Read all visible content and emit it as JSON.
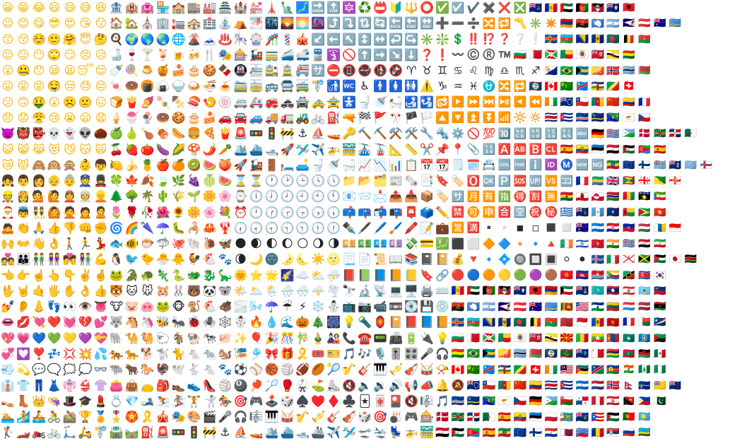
{
  "sheet": {
    "columns": 47,
    "rows": 28,
    "description_groups": [
      "faces",
      "buildings",
      "nature",
      "objects",
      "symbols",
      "flags"
    ]
  },
  "rows": [
    "😀😁😂😃😄😅😆🏦🏨🏩🏪🏫🏬🏭🏯🏰💒🗼🗽🗾🔜🔝🔯♻️📛🔰🔱⭕✅☑️✔️✖️❌❎🇦🇨🇦🇩🇦🇪🇦🇫🇦🇬🇦🇮🇦🇱",
    "😉😊😋😎😍😘😗🏠🏡⛪🏢🏣🏤🏥⛲⛺🌁🌃🌄🌅🌆⤴️⤵️🔃🔄🔙🔚🔛➕➖➗🔀🔁〽️✳️✴️🇦🇲🇦🇴🇦🇶🇦🇷🇦🇸🇦🇹🇦🇺🇦🇼",
    "😙😚☺️🙂🤗😇🤔🍳🌍🌎🌏🌐🌋🗻♨️🎠🎡🎢💈🎪↙️⬅️↖️↕️↔️↩️↪️✳️❇️💲‼️⁉️❓❔❕🇦🇽🇦🇿🇧🇦🇧🇧🇧🇩🇧🇪🇧🇫",
    "😐😑😶🙄😏😣😥🍶🍷🍸🍹🍺🍻🍴🎭🎰🚂🚃🚄🚅🚆🛐🚫⬆️➡️↘️⬇️❓❗〰️©️®️™️🇧🇬🇧🇭🇧🇮🇧🇯🇧🇱🇧🇲🇧🇳🇧🇴",
    "😮🤐😯😪😫😴😌🍼🍭🍮🍯🍰🎂🍪🍫🚇🚈🚉🚊🚝🈂️⛔📵🚭🚯🚱♈♉♊♋♌♍♎♏♐🇧🇶🇧🇷🇧🇸🇧🇹🇧🇻🇧🇼🇧🇾",
    "😛😜😝🤤😒😓😔🍬🍩🍘🍙🍚🍛🍜🍝🚞🚋🚌🚍🚎🚏🚮🚾♿🚹🚺🚻⚠️♑♒♓⛎🔀🔁🇧🇿🇨🇦🇨🇨🇨🇩🇨🇫🇨🇬🇨🇭",
    "😕🙃🤑😲☹️🙁😖🍞🍟🍠🍡🍢🍣🍤🍥🚐🚑🚒🚓🚔🚕🚖🚼🚽🚿🛀🛃🛂🔂▶️⏩⏭️⏯️◀️⏪🇨🇮🇨🇰🇨🇱🇨🇲🇨🇳🇨🇴🇨🇵",
    "😞😟😤😢😭😦😧🍦🍧🍨🍩🍪🎂🍰🚗🚘🚙🚚🚛🚜🚲⛽🔫🏁🚩🎌🏴🏳️🔼🔽⏫⏬📶🔆🔅🇨🇷🇨🇺🇨🇻🇨🇼🇨🇽🇨🇾🇨🇿",
    "👿👹👺💀👻👽🌰🍏🍐🍗🍖🌭🍔🍕🍟🚨🚥🚦🚧⚓⛵🚤🔑🔨⛏️⚒️🛠️🔧🔩⚙️🚫💯🔟🔠🔡🔢🔣🔤🇩🇪🇩🇬🇩🇯🇩🇰🇩🇲🇩🇴🇩🇿",
    "😺😸😹😻😼😽🙀🍒🍓🍅🍆🌽🍄🌶️🥕🛳️⛴️🛥️🚀🛩️✈️🚁🚟🚠🚡📐📏✂️📌📍📎🔢🅰️🆎🅱️🆑🇪🇦🇪🇨🇪🇪🇪🇬🇪🇭🇪🇷🇪🇸",
    "😿😾🙈🙉🙊👶👦🍋🍌🍍🍎🍊🥝🍉🍑🚀🚂🚪🛏️🛋️🚽🚿🛁📈📉📊📋📅📆🗒️🗓️📇🆒🆓ℹ️🆔Ⓜ️🆕🆖🇪🇹🇪🇺🇫🇮🇫🇯🇫🇰🇫🇲🇫🇴",
    "👧👨👩👴👵👮💂🍀🍁🍂🍃🌿🍇🍈🍉⌛⏳🕐🕑🕒🕓🕔📁📂🗂️📰🗞️📑🔖🏷️🅾️🆗🅿️🆘🆙🆚🈁🇫🇷🇬🇦🇬🇧🇬🇩🇬🇪🇬🇫🇬🇬",
    "👷👸💁🙋👲👳👱🌲🌳🌴🌵🌾🌱🌼🌸⌚🕕🕖🕗🕘🕙🕚📧📨📩📤📥📦🏷️🈂️🈷️🈶🈯🉐🈹🈚🇬🇭🇬🇮🇬🇱🇬🇲🇬🇳🇬🇵🇬🇶",
    "🎅👼👯🙆🙅🙍🙎🌷🌹🥀🌺🌻🌼🌸💐⏰🕛🕜🕝🕞🕟🕠📫📪📬📭📮🗳️✏️🈲🉑🈸🈴🈳㊗️㊙️🇬🇷🇬🇸🇬🇹🇬🇺🇬🇼🇬🇾🇭🇰",
    "🙇👏🙏👍👎👊✊🌀🌈🌂☂️🐛🦂🦀🦞🕡🕢🕣🕤🕥🕦🕧✒️🖋️🖊️🖌️🖍️📝💼🈺🈵▪️▫️◾◽◼️◻️🇭🇲🇭🇳🇭🇷🇭🇹🇭🇺🇮🇨🇮🇩",
    "🙌👐👋👌🚶🏃💃🐟🐠🐡🦈🐙🐚🐌🦋🌑🌒🌓🌔🌕🌖🌗💴💵💶💷💸💳💹⬛⬜🔶🔷🔸🔹🔺🇮🇪🇮🇱🇮🇲🇮🇳🇮🇴🇮🇶🇮🇷",
    "💑👪👬👭💏👫💪🐧🐦🐤🐣🐥🐓🐔🐾🌘🌙🌚🌛🌜☀️🌝📃📄📜📖📚📓📔💰🔻🔹💠🔘🔲🔳⚪⚫🇮🇸🇮🇹🇯🇪🇯🇲🇯🇴🇯🇵🇰🇪",
    "👈👉☝️👆👇✌️🤞🐸🐊🐢🦎🐍🐲🐉🦕🌞⭐🌟🌠☁️⛅⛈️📕📗📘📙📒🔖🔗🔴🔵🟠🟡🟢🟣🟤🇰🇬🇰🇭🇰🇮🇰🇲🇰🇳🇰🇵🇰🇷",
    "🖖🤘🤙🖐️✋👌👍🐯🐱🐭🐹🐰🐻🐼🐨🌤️🌥️🌦️🌧️🌨️🌩️🌪️🔭🔬📡💻🖥️🖨️⌨️🇦🇩🇦🇪🇦🇫🇦🇬🇦🇮🇦🇱🇦🇲🇰🇼🇰🇾🇰🇿🇱🇦🇱🇧🇱🇨🇱🇮",
    "💅👂👃👣👀👁️👅🐮🐷🐽🐸🐵🐒🐔🐗🌫️🌬️☂️☔⚡❄️⛄📺📷📹📼💽💾💿🇦🇴🇦🇶🇦🇷🇦🇸🇦🇹🇦🇺🇦🇼🇱🇰🇱🇷🇱🇸🇱🇹🇱🇺🇱🇻🇱🇾",
    "👄💋💘❤️💓💔💕🐺🐴🦄🐝🐜🐞🕷️🕸️☃️🔥💧🌊🎃🎄🎆💡🔦🏮📔📕📘📙🇦🇽🇦🇿🇧🇦🇧🇧🇧🇩🇧🇪🇧🇫🇲🇦🇲🇨🇲🇩🇲🇪🇲🇫🇲🇬🇲🇭",
    "💖💗💙💚💛💜💝🐘🐪🐫🐑🐐🐏🐄🐖✨🎈🎉🎊🎋🎍🎎📞☎️📟📠🔋🔌💡🇧🇬🇧🇭🇧🇮🇧🇯🇧🇱🇧🇲🇧🇳🇲🇰🇲🇱🇲🇲🇲🇳🇲🇴🇲🇵🇲🇶",
    "💞💟❣️💤💢💥💦🐅🐆🐕🐩🐈🐁🐀🐿️🎏🎐🎀🎁🎗️🎟️🎫🎵🎶🎙️🎚️🎛️🎤🎧🇧🇴🇧🇷🇧🇸🇧🇹🇧🇼🇧🇾🇧🇿🇲🇷🇲🇸🇲🇹🇲🇺🇲🇻🇲🇼🇲🇽",
    "💨💫💬🗨️🗯️💭👓🐃🐂🐎🦃🕊️🐇🐁🐾⚽⚾🏀🏐🏈🏉🎾🎷🎸🎹🎺🎻🥁📯🇨🇦🇨🇨🇨🇩🇨🇫🇨🇬🇨🇭🇨🇮🇲🇾🇲🇿🇳🇦🇳🇨🇳🇪🇳🇫🇳🇬",
    "👔👕👖👗👘👙👚👛👜👝🎒👞👟👠🏐🎱🏓🏸🥊🥋⛳⛸️🔇🔈🔉🔊📢📣🔔🔕🇨🇰🇨🇱🇨🇲🇨🇳🇨🇴🇨🇷🇨🇺🇳🇮🇳🇱🇳🇴🇳🇵🇳🇷🇳🇺🇳🇿",
    "👡👢👑👒🎩🎓💄💍💎🎿⛷️🏂🏋️🤺🏇🎯🎮🕹️🎲♠️♥️♦️♣️🃏🀄🎴🔇🎼🎵🇨🇻🇨🇼🇨🇽🇨🇾🇨🇿🇩🇪🇩🇯🇴🇲🇵🇦🇵🇪🇵🇫🇵🇬🇵🇭🇵🇰",
    "🏊🏄🚣🚴🚵🏆🏅🎖️🏵️🎗️🎪🎭🎨🎬🎤🎧🎼🎹🥁🎷🎺🎸🎻🎲🎯🎳🎮🎰🇩🇰🇩🇲🇩🇴🇩🇿🇪🇦🇪🇨🇪🇪🇵🇱🇵🇲🇵🇳🇵🇷🇵🇸🇵🇹🇵🇼",
    "🏌️🏎️🏍️🚲🛴🛵🚏🛣️🛤️⛽🚨🚥🚦🚧⚓⛵🚤🛳️⛴️🛥️🚢✈️🛩️🛫🛬💺🚁🚟🇪🇬🇪🇭🇪🇷🇪🇸🇪🇹🇪🇺🇫🇮🇵🇾🇶🇦🇷🇪🇷🇴🇷🇸🇷🇺🇷🇼"
  ]
}
